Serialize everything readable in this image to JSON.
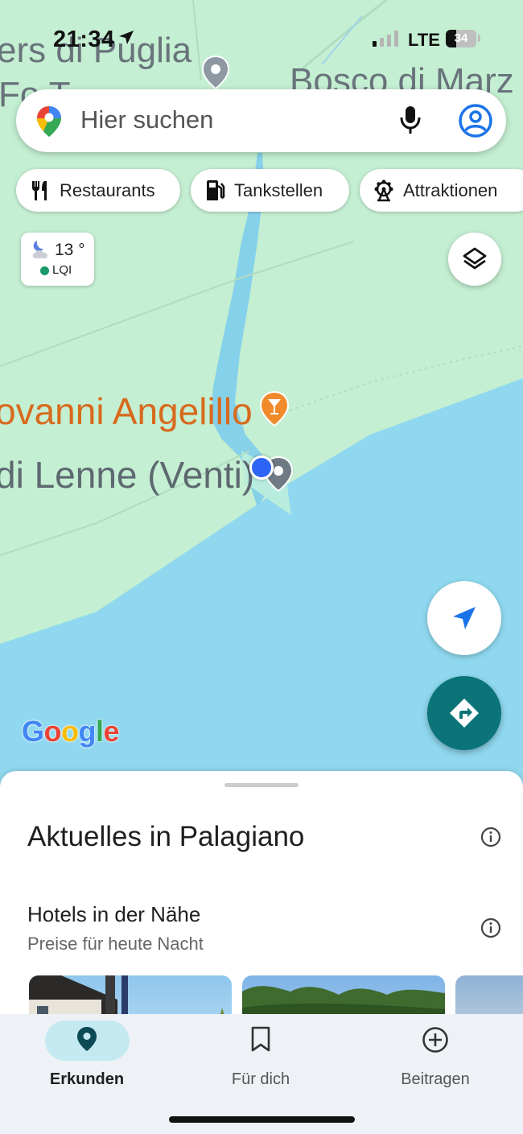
{
  "status_bar": {
    "time": "21:34",
    "network": "LTE",
    "battery": "34",
    "battery_level": 0.34
  },
  "map": {
    "labels": {
      "poi_top_line1": "ers di Puglia",
      "poi_top_line2": "Fo  T",
      "bosco": "Bosco di Marz",
      "restaurant": "ovanni Angelillo",
      "place": "di Lenne (Venti)"
    },
    "attribution": "Google",
    "colors": {
      "land": "#c4efd2",
      "water": "#8fd8ef",
      "river": "#86d1ea",
      "accent": "#0b7478",
      "location_dot": "#2e64f5",
      "poi_orange": "#f08a2a"
    }
  },
  "search": {
    "placeholder": "Hier suchen",
    "icons": {
      "logo": "maps-pin-icon",
      "mic": "mic-icon",
      "account": "account-icon"
    }
  },
  "chips": [
    {
      "label": "Restaurants",
      "icon": "fork-knife-icon"
    },
    {
      "label": "Tankstellen",
      "icon": "gas-station-icon"
    },
    {
      "label": "Attraktionen",
      "icon": "ferris-wheel-icon"
    }
  ],
  "weather": {
    "temperature": "13 °",
    "air_quality": "LQI",
    "icon": "night-cloud-icon"
  },
  "sheet": {
    "title": "Aktuelles in Palagiano",
    "section_title": "Hotels in der Nähe",
    "section_subtitle": "Preise für heute Nacht"
  },
  "nav": [
    {
      "label": "Erkunden",
      "icon": "explore-pin-icon",
      "active": true
    },
    {
      "label": "Für dich",
      "icon": "bookmark-icon",
      "active": false
    },
    {
      "label": "Beitragen",
      "icon": "plus-circle-icon",
      "active": false
    }
  ]
}
